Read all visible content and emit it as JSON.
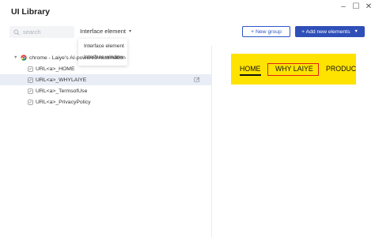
{
  "window": {
    "title": "UI Library",
    "controls": {
      "minimize": "–",
      "maximize": "☐",
      "close": "✕"
    }
  },
  "toolbar": {
    "search_placeholder": "search",
    "filter_label": "Interface element",
    "filter_options": [
      "Interface element",
      "Interface window"
    ],
    "new_group_label": "+ New group",
    "add_elements_label": "+ Add new elements"
  },
  "tree": {
    "root_label": "chrome - Laiye's AI-powered Automation",
    "items": [
      {
        "label": "URL<a>_HOME",
        "selected": false
      },
      {
        "label": "URL<a>_WHYLAIYE",
        "selected": true
      },
      {
        "label": "URL<a>_TermsofUse",
        "selected": false
      },
      {
        "label": "URL<a>_PrivacyPolicy",
        "selected": false
      }
    ]
  },
  "preview": {
    "nav": [
      "HOME",
      "WHY LAIYE",
      "PRODUCT"
    ],
    "highlighted": "WHY LAIYE",
    "background": "#ffe300",
    "highlight_color": "#e0201b"
  },
  "colors": {
    "accent": "#2f4fb8",
    "selected_row": "#e9edf6"
  }
}
